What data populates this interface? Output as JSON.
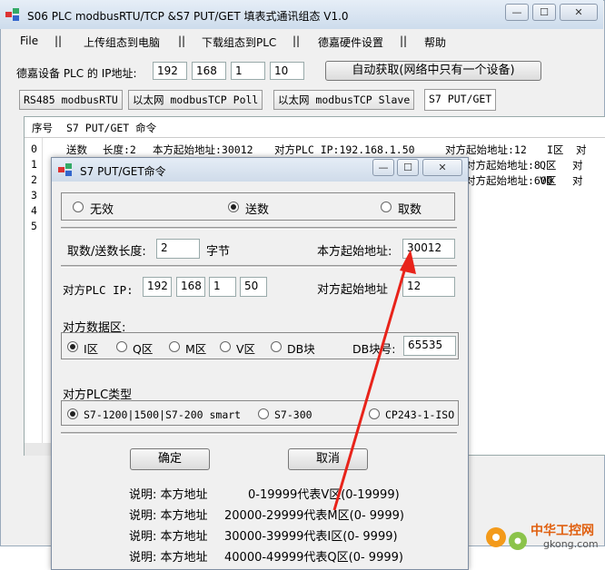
{
  "window": {
    "title": "S06 PLC modbusRTU/TCP &S7 PUT/GET 填表式通讯组态  V1.0",
    "min_btn": "—",
    "max_btn": "☐",
    "close_btn": "✕"
  },
  "menu": [
    {
      "label": "File"
    },
    {
      "label": "||"
    },
    {
      "label": "上传组态到电脑"
    },
    {
      "label": "||"
    },
    {
      "label": "下载组态到PLC"
    },
    {
      "label": "||"
    },
    {
      "label": "德嘉硬件设置"
    },
    {
      "label": "||"
    },
    {
      "label": "帮助"
    }
  ],
  "ip_row": {
    "label": "德嘉设备 PLC 的 IP地址:",
    "ip": [
      "192",
      "168",
      "1",
      "10"
    ],
    "auto_button": "自动获取(网络中只有一个设备)"
  },
  "tabs": [
    {
      "label": "RS485 modbusRTU",
      "selected": false
    },
    {
      "label": "以太网 modbusTCP Poll",
      "selected": false
    },
    {
      "label": "以太网 modbusTCP Slave",
      "selected": false
    },
    {
      "label": "S7 PUT/GET",
      "selected": true
    }
  ],
  "list": {
    "header_no": "序号",
    "header_cmd": "S7 PUT/GET 命令",
    "rows": [
      {
        "no": "0",
        "c1": "送数",
        "c2": "长度:2",
        "c3": "本方起始地址:30012",
        "c4": "对方PLC IP:192.168.1.50",
        "c5": "对方起始地址:12",
        "c6": "I区",
        "c7": "对"
      },
      {
        "no": "1",
        "c1": "",
        "c2": "",
        "c3": "",
        "c4": "",
        "c5": "对方起始地址:8",
        "c6": "Q区",
        "c7": "对"
      },
      {
        "no": "2",
        "c1": "",
        "c2": "",
        "c3": "",
        "c4": "",
        "c5": "对方起始地址:600",
        "c6": "V区",
        "c7": "对"
      },
      {
        "no": "3"
      },
      {
        "no": "4"
      },
      {
        "no": "5"
      }
    ]
  },
  "dialog": {
    "title": "S7 PUT/GET命令",
    "mode_options": [
      {
        "label": "无效",
        "selected": false
      },
      {
        "label": "送数",
        "selected": true
      },
      {
        "label": "取数",
        "selected": false
      }
    ],
    "length_label": "取数/送数长度:",
    "length_value": "2",
    "length_unit": "字节",
    "local_addr_label": "本方起始地址:",
    "local_addr_value": "30012",
    "peer_ip_label": "对方PLC IP:",
    "peer_ip": [
      "192",
      "168",
      "1",
      "50"
    ],
    "peer_addr_label": "对方起始地址",
    "peer_addr_value": "12",
    "area_label": "对方数据区:",
    "areas": [
      {
        "label": "I区",
        "selected": true
      },
      {
        "label": "Q区",
        "selected": false
      },
      {
        "label": "M区",
        "selected": false
      },
      {
        "label": "V区",
        "selected": false
      },
      {
        "label": "DB块",
        "selected": false
      }
    ],
    "db_label": "DB块号:",
    "db_value": "65535",
    "plc_type_label": "对方PLC类型",
    "plc_types": [
      {
        "label": "S7-1200|1500|S7-200 smart",
        "selected": true
      },
      {
        "label": "S7-300",
        "selected": false
      },
      {
        "label": "CP243-1-ISO",
        "selected": false
      }
    ],
    "ok_button": "确定",
    "cancel_button": "取消",
    "notes": [
      {
        "a": "说明: 本方地址",
        "b": "0-19999代表V区(0-19999)"
      },
      {
        "a": "说明: 本方地址",
        "b": "20000-29999代表M区(0- 9999)"
      },
      {
        "a": "说明: 本方地址",
        "b": "30000-39999代表I区(0- 9999)"
      },
      {
        "a": "说明: 本方地址",
        "b": "40000-49999代表Q区(0- 9999)"
      }
    ]
  },
  "watermark": {
    "line1": "中华工控网",
    "line2": "gkong.com"
  },
  "colors": {
    "arrow": "#e8231a",
    "accent": "#0a5fcc"
  }
}
